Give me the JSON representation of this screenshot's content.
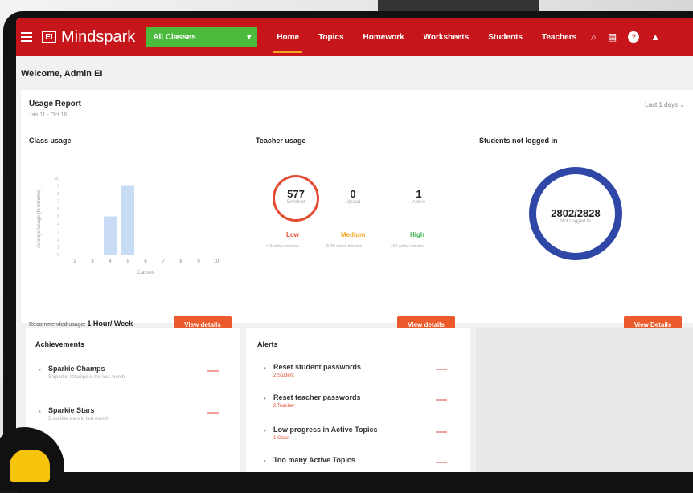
{
  "app": {
    "logo": "Mindspark"
  },
  "header": {
    "class_select": "All Classes",
    "nav": [
      "Home",
      "Topics",
      "Homework",
      "Worksheets",
      "Students",
      "Teachers"
    ]
  },
  "welcome": "Welcome, Admin EI",
  "usage_report": {
    "title": "Usage Report",
    "date_range": "Jan 11 - Oct 16",
    "period": "Last 1 days",
    "class_usage": {
      "title": "Class usage",
      "ylabel": "Average Usage (In minutes)",
      "xlabel": "Classes"
    },
    "teacher_usage": {
      "title": "Teacher usage",
      "stats": [
        {
          "value": "577",
          "label": "Enrolled"
        },
        {
          "value": "0",
          "label": "Upload"
        },
        {
          "value": "1",
          "label": "Active"
        }
      ],
      "levels": [
        {
          "label": "Low",
          "sub": "<15 active minutes",
          "color": "#e34a2f"
        },
        {
          "label": "Medium",
          "sub": "15-60 active minutes",
          "color": "#f6a623"
        },
        {
          "label": "High",
          "sub": ">60 active minutes",
          "color": "#3eb34f"
        }
      ]
    },
    "students_not_logged": {
      "title": "Students not logged in",
      "value": "2802/2828",
      "label": "Not Logged In"
    },
    "recommended_label": "Recommended usage:",
    "recommended_value": "1 Hour/ Week",
    "view_details": "View details",
    "view_details_alt": "View Details"
  },
  "achievements": {
    "title": "Achievements",
    "items": [
      {
        "title": "Sparkie Champs",
        "sub": "3 Sparkie Champs in the last month"
      },
      {
        "title": "Sparkie Stars",
        "sub": "5 sparkie stars in last month"
      }
    ]
  },
  "alerts": {
    "title": "Alerts",
    "items": [
      {
        "title": "Reset student passwords",
        "sub": "2 Student"
      },
      {
        "title": "Reset teacher passwords",
        "sub": "2 Teacher"
      },
      {
        "title": "Low progress in Active Topics",
        "sub": "1 Class"
      },
      {
        "title": "Too many Active Topics",
        "sub": ""
      }
    ]
  },
  "chart_data": {
    "type": "bar",
    "categories": [
      "2",
      "3",
      "4",
      "5",
      "6",
      "7",
      "8",
      "9",
      "10"
    ],
    "values": [
      0,
      0,
      5,
      9,
      0,
      0,
      0,
      0,
      0
    ],
    "ylabel": "Average Usage (In minutes)",
    "xlabel": "Classes",
    "ylim": [
      0,
      10
    ],
    "yticks": [
      "10",
      "9",
      "8",
      "7",
      "6",
      "5",
      "4",
      "3",
      "2",
      "1",
      "0"
    ],
    "color": "#c9dcf5"
  }
}
